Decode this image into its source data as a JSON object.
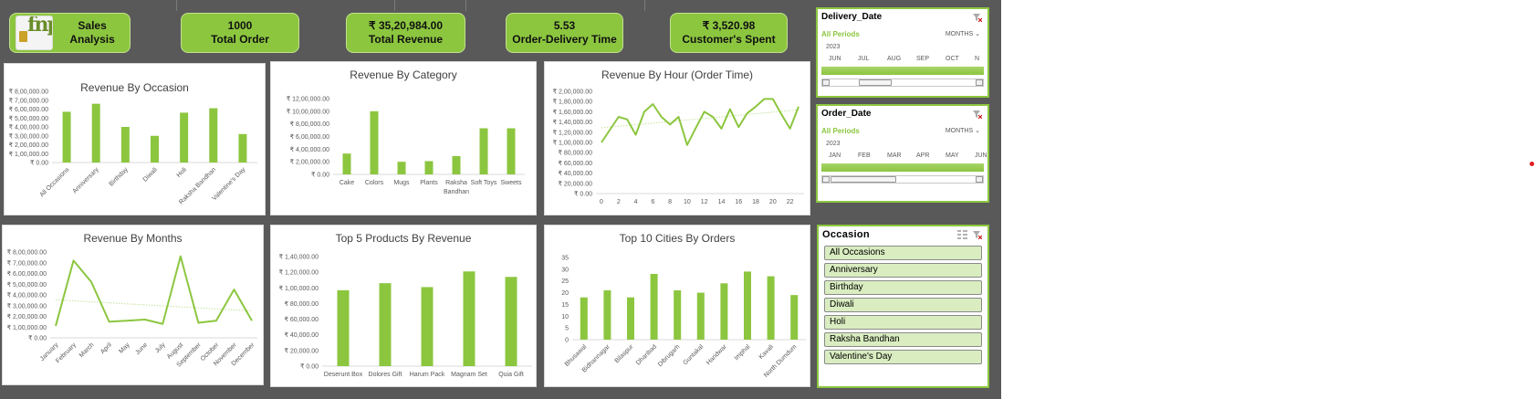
{
  "kpis": {
    "logo_text": "fnp",
    "title": "Sales Analysis",
    "total_order_value": "1000",
    "total_order_label": "Total Order",
    "total_revenue_value": "₹ 35,20,984.00",
    "total_revenue_label": "Total Revenue",
    "delivery_time_value": "5.53",
    "delivery_time_label": "Order-Delivery Time",
    "customer_spent_value": "₹ 3,520.98",
    "customer_spent_label": "Customer's Spent"
  },
  "colors": {
    "accent": "#8cc63f",
    "background": "#595959",
    "trend": "#c5e29a"
  },
  "chart_data": [
    {
      "id": "occasion",
      "type": "bar",
      "title": "Revenue By Occasion",
      "categories": [
        "All Occasions",
        "Anniversary",
        "Birthday",
        "Diwali",
        "Holi",
        "Raksha Bandhan",
        "Valentine's Day"
      ],
      "values": [
        570000,
        660000,
        400000,
        300000,
        560000,
        610000,
        320000
      ],
      "ylim": [
        0,
        800000
      ],
      "yticks": [
        "₹ 0.00",
        "₹ 1,00,000.00",
        "₹ 2,00,000.00",
        "₹ 3,00,000.00",
        "₹ 4,00,000.00",
        "₹ 5,00,000.00",
        "₹ 6,00,000.00",
        "₹ 7,00,000.00",
        "₹ 8,00,000.00"
      ]
    },
    {
      "id": "category",
      "type": "bar",
      "title": "Revenue By Category",
      "categories": [
        "Cake",
        "Colors",
        "Mugs",
        "Plants",
        "Raksha Bandhan",
        "Soft Toys",
        "Sweets"
      ],
      "values": [
        330000,
        1000000,
        200000,
        210000,
        290000,
        730000,
        730000
      ],
      "ylim": [
        0,
        1200000
      ],
      "yticks": [
        "₹ 0.00",
        "₹ 2,00,000.00",
        "₹ 4,00,000.00",
        "₹ 6,00,000.00",
        "₹ 8,00,000.00",
        "₹ 10,00,000.00",
        "₹ 12,00,000.00"
      ]
    },
    {
      "id": "hour",
      "type": "line",
      "title": "Revenue By Hour (Order Time)",
      "x": [
        0,
        1,
        2,
        3,
        4,
        5,
        6,
        7,
        8,
        9,
        10,
        11,
        12,
        13,
        14,
        15,
        16,
        17,
        18,
        19,
        20,
        21,
        22,
        23
      ],
      "values": [
        100000,
        125000,
        150000,
        145000,
        115000,
        160000,
        175000,
        150000,
        135000,
        150000,
        95000,
        128000,
        160000,
        150000,
        127000,
        165000,
        130000,
        157000,
        170000,
        185000,
        185000,
        155000,
        127000,
        170000
      ],
      "xticks": [
        "0",
        "2",
        "4",
        "6",
        "8",
        "10",
        "12",
        "14",
        "16",
        "18",
        "20",
        "22"
      ],
      "ylim": [
        0,
        200000
      ],
      "yticks": [
        "₹ 0.00",
        "₹ 20,000.00",
        "₹ 40,000.00",
        "₹ 60,000.00",
        "₹ 80,000.00",
        "₹ 1,00,000.00",
        "₹ 1,20,000.00",
        "₹ 1,40,000.00",
        "₹ 1,60,000.00",
        "₹ 1,80,000.00",
        "₹ 2,00,000.00"
      ],
      "trendline": true
    },
    {
      "id": "months",
      "type": "line",
      "title": "Revenue By Months",
      "categories": [
        "January",
        "February",
        "March",
        "April",
        "May",
        "June",
        "July",
        "August",
        "September",
        "October",
        "November",
        "December"
      ],
      "values": [
        110000,
        720000,
        520000,
        150000,
        160000,
        170000,
        130000,
        760000,
        140000,
        160000,
        450000,
        160000
      ],
      "ylim": [
        0,
        800000
      ],
      "yticks": [
        "₹ 0.00",
        "₹ 1,00,000.00",
        "₹ 2,00,000.00",
        "₹ 3,00,000.00",
        "₹ 4,00,000.00",
        "₹ 5,00,000.00",
        "₹ 6,00,000.00",
        "₹ 7,00,000.00",
        "₹ 8,00,000.00"
      ],
      "trendline": true
    },
    {
      "id": "products",
      "type": "bar",
      "title": "Top 5 Products By Revenue",
      "categories": [
        "Deserunt Box",
        "Dolores Gift",
        "Harum Pack",
        "Magnam Set",
        "Quia Gift"
      ],
      "values": [
        97000,
        106000,
        101000,
        121000,
        114000
      ],
      "ylim": [
        0,
        140000
      ],
      "yticks": [
        "₹ 0.00",
        "₹ 20,000.00",
        "₹ 40,000.00",
        "₹ 60,000.00",
        "₹ 80,000.00",
        "₹ 1,00,000.00",
        "₹ 1,20,000.00",
        "₹ 1,40,000.00"
      ]
    },
    {
      "id": "cities",
      "type": "bar",
      "title": "Top 10 Cities By Orders",
      "categories": [
        "Bhusawal",
        "Bidhannagar",
        "Bilaspur",
        "Dhanbad",
        "Dibrugarh",
        "Guntakal",
        "Haridwar",
        "Imphal",
        "Kavali",
        "North Dumdum"
      ],
      "values": [
        18,
        21,
        18,
        28,
        21,
        20,
        24,
        29,
        27,
        19
      ],
      "ylim": [
        0,
        35
      ],
      "yticks": [
        "0",
        "5",
        "10",
        "15",
        "20",
        "25",
        "30",
        "35"
      ]
    }
  ],
  "slicers": {
    "delivery": {
      "title": "Delivery_Date",
      "all_periods": "All Periods",
      "unit": "MONTHS",
      "year": "2023",
      "months": [
        "JUN",
        "JUL",
        "AUG",
        "SEP",
        "OCT",
        "N"
      ]
    },
    "order": {
      "title": "Order_Date",
      "all_periods": "All Periods",
      "unit": "MONTHS",
      "year": "2023",
      "months": [
        "JAN",
        "FEB",
        "MAR",
        "APR",
        "MAY",
        "JUN"
      ]
    },
    "occasion": {
      "title": "Occasion",
      "items": [
        "All Occasions",
        "Anniversary",
        "Birthday",
        "Diwali",
        "Holi",
        "Raksha Bandhan",
        "Valentine's Day"
      ]
    }
  }
}
